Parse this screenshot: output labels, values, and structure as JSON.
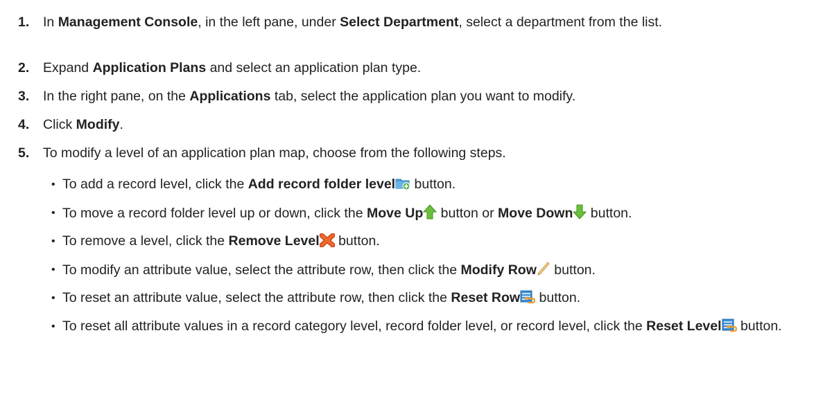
{
  "steps": [
    {
      "num": "1.",
      "t1": "In ",
      "b1": "Management Console",
      "t2": ", in the left pane, under ",
      "b2": "Select Department",
      "t3": ", select a department from the list."
    },
    {
      "num": "2.",
      "t1": "Expand ",
      "b1": "Application Plans",
      "t2": " and select an application plan type."
    },
    {
      "num": "3.",
      "t1": "In the right pane, on the ",
      "b1": "Applications",
      "t2": " tab, select the application plan you want to modify."
    },
    {
      "num": "4.",
      "t1": "Click ",
      "b1": "Modify",
      "t2": "."
    },
    {
      "num": "5.",
      "t1": "To modify a level of an application plan map, choose from the following steps."
    }
  ],
  "bullets": [
    {
      "t1": "To add a record level, click the ",
      "b1": "Add record folder level",
      "icon": "add-folder-icon",
      "t2": " button."
    },
    {
      "t1": "To move a record folder level up or down, click the ",
      "b1": "Move Up",
      "icon1": "arrow-up-icon",
      "t2": " button or ",
      "b2": "Move Down",
      "icon2": "arrow-down-icon",
      "t3": " button."
    },
    {
      "t1": "To remove a level, click the ",
      "b1": "Remove Level",
      "icon": "remove-x-icon",
      "t2": " button."
    },
    {
      "t1": "To modify an attribute value, select the attribute row, then click the ",
      "b1": "Modify Row",
      "icon": "pencil-icon",
      "t2": "  button."
    },
    {
      "t1": "To reset an attribute value, select the attribute row, then click the ",
      "b1": "Reset Row",
      "icon": "reset-icon",
      "t2": " button."
    },
    {
      "t1": "To reset all attribute values in a record category level, record folder level, or record level, click the ",
      "b1": "Reset Level",
      "icon": "reset-icon",
      "t2": " button."
    }
  ],
  "bullet_glyph": "•",
  "colors": {
    "text": "#222222",
    "arrow_up": "#6bbf3a",
    "arrow_down": "#6bbf3a",
    "remove": "#e8501a",
    "folder": "#4a9ed8",
    "plus": "#4caf3e",
    "pencil": "#e8c27a",
    "reset": "#3a8fd6",
    "reset_arrow": "#f0a030"
  }
}
